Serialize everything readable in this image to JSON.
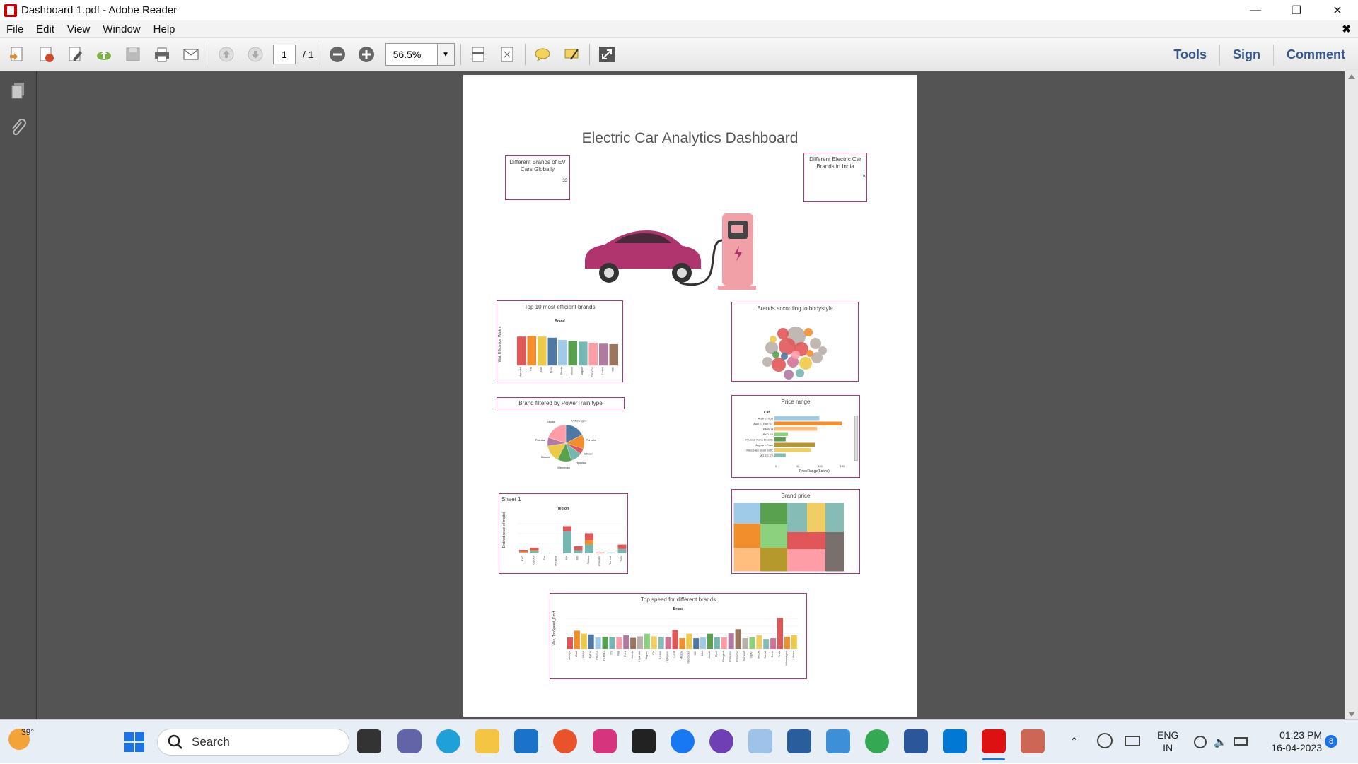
{
  "window": {
    "title": "Dashboard 1.pdf - Adobe Reader",
    "minimize": "—",
    "restore": "❐",
    "close": "✕"
  },
  "menu": {
    "items": [
      "File",
      "Edit",
      "View",
      "Window",
      "Help"
    ],
    "close_doc": "✖"
  },
  "toolbar": {
    "page_current": "1",
    "page_total": "/ 1",
    "zoom": "56.5%",
    "tools": "Tools",
    "sign": "Sign",
    "comment": "Comment"
  },
  "dashboard": {
    "title": "Electric Car Analytics Dashboard",
    "card_global": "Different Brands of EV Cars Globally",
    "card_global_value": "33",
    "card_india": "Different Electric Car Brands in India",
    "card_india_value": "9",
    "top10_title": "Top 10 most efficient brands",
    "top10_header": "Brand",
    "top10_ylabel": "Wat, Efficiency, Wh/km",
    "bodystyle_title": "Brands according to bodystyle",
    "powertrain_title": "Brand filtered by PowerTrain type",
    "price_title": "Price range",
    "price_header": "Car",
    "price_xlabel": "PriceRange(Lakhs)",
    "sheet1_title": "Sheet 1",
    "sheet1_header": "region",
    "sheet1_ylabel": "Distinct count of model",
    "brandprice_title": "Brand price",
    "topspeed_title": "Top speed for different brands",
    "topspeed_header": "Brand",
    "topspeed_ylabel": "Max, TopSpeed_KmH"
  },
  "colors": {
    "accent_card_border": "#b0357a",
    "car_body": "#b0356f",
    "charger": "#f0a0a6",
    "viewer_bg": "#545454",
    "tool_link": "#37588a"
  },
  "charts": {
    "top10": {
      "type": "bar",
      "categories": [
        "Hyundai",
        "Kia",
        "Audi",
        "Tesla",
        "Skoda",
        "Nissan",
        "Jaguar",
        "Porsche",
        "Lexus",
        "MG"
      ],
      "values": [
        255,
        260,
        255,
        245,
        225,
        218,
        210,
        200,
        192,
        188
      ],
      "ylim": [
        0,
        300
      ]
    },
    "powertrain": {
      "type": "pie",
      "labels": [
        "Volkswagen",
        "Porsche",
        "Citroen",
        "Hyundai",
        "Mercedes",
        "Nissan",
        "Polestar",
        "Skoda"
      ],
      "values": [
        7,
        5,
        2,
        4,
        5,
        6,
        3,
        8
      ],
      "colors": [
        "#4e79a7",
        "#f28e2b",
        "#e15759",
        "#76b7b2",
        "#59a14f",
        "#edc948",
        "#b07aa1",
        "#ff9da7",
        "#9c755f",
        "#bab0ac"
      ]
    },
    "price": {
      "type": "bar",
      "categories": [
        "Audi E-Tron",
        "Audi E-Tron GT",
        "BMW i4",
        "BYD E6",
        "Hyundai Kona Electric",
        "Jaguar I-Pace",
        "Mercedes Benz EQC",
        "MG ZS EV"
      ],
      "values": [
        100,
        150,
        95,
        30,
        25,
        90,
        82,
        25
      ],
      "colors": [
        "#a0cbe8",
        "#f28e2b",
        "#ffbe7d",
        "#8cd17d",
        "#59a14f",
        "#b6992d",
        "#f1ce63",
        "#86bcb6"
      ],
      "xlim": [
        0,
        150
      ],
      "xticks": [
        "0",
        "50",
        "100",
        "150"
      ]
    },
    "sheet1": {
      "type": "stacked-bar",
      "categories": [
        "BYD",
        "Citroen",
        "Fiat",
        "Hyundai",
        "Kia",
        "MG",
        "Nissan",
        "Polestar",
        "Renault",
        "Seat"
      ],
      "series": [
        {
          "values": [
            2,
            6,
            1,
            0,
            50,
            7,
            20,
            0,
            2,
            10
          ],
          "color": "#76b7b2"
        },
        {
          "values": [
            2,
            2,
            0,
            0,
            0,
            0,
            10,
            0,
            0,
            0
          ],
          "color": "#f28e2b"
        },
        {
          "values": [
            4,
            5,
            0,
            0,
            12,
            9,
            16,
            2,
            0,
            10
          ],
          "color": "#e15759"
        }
      ],
      "ylim": [
        0,
        90
      ]
    },
    "topspeed": {
      "type": "bar",
      "categories": [
        "Aiways",
        "Audi",
        "BMW",
        "Byton",
        "Citroen",
        "CUPRA",
        "DS",
        "Fiat",
        "Ford",
        "Honda",
        "Hyundai",
        "Jaguar",
        "Kia",
        "Lexus",
        "Lightyear",
        "Lucid",
        "Mazda",
        "Mercedes",
        "MG",
        "Mini",
        "Nissan",
        "Opel",
        "Peugeot",
        "Polestar",
        "Porsche",
        "Renault",
        "SEAT",
        "Skoda",
        "Smart",
        "Sono",
        "Tesla",
        "Volkswagen",
        "Volvo"
      ],
      "values": [
        150,
        240,
        200,
        190,
        150,
        160,
        150,
        150,
        180,
        145,
        165,
        200,
        165,
        160,
        150,
        250,
        140,
        200,
        140,
        150,
        200,
        150,
        150,
        205,
        260,
        140,
        150,
        180,
        130,
        140,
        410,
        160,
        180
      ],
      "ylim": [
        0,
        450
      ]
    }
  },
  "taskbar": {
    "weather": "39°",
    "search": "Search",
    "lang1": "ENG",
    "lang2": "IN",
    "time": "01:23 PM",
    "date": "16-04-2023",
    "notif": "8"
  }
}
